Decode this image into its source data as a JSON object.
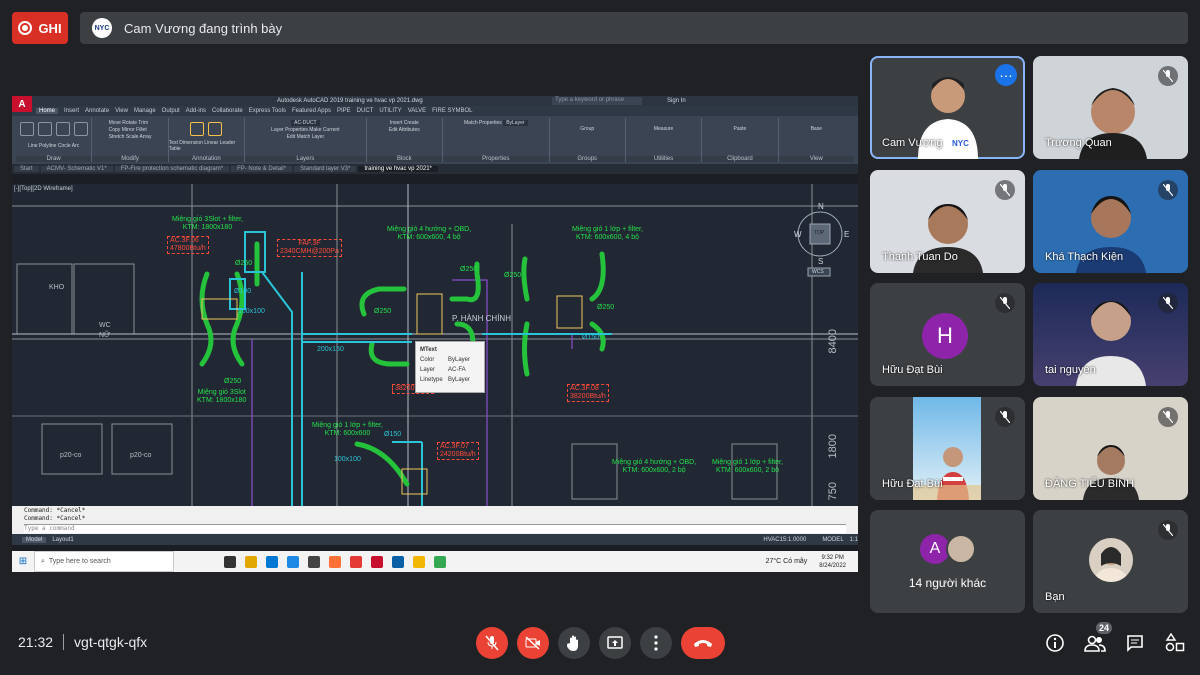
{
  "top": {
    "record_label": "GHI",
    "presenter_initials": "NYC",
    "presenter_text": "Cam Vương đang trình bày"
  },
  "acad": {
    "title": "Autodesk AutoCAD 2019   training ve hvac vp 2021.dwg",
    "search_placeholder": "Type a keyword or phrase",
    "sign_in": "Sign In",
    "logo": "A",
    "menu_tabs": [
      "Home",
      "Insert",
      "Annotate",
      "View",
      "Manage",
      "Output",
      "Add-ins",
      "Collaborate",
      "Express Tools",
      "Featured Apps",
      "PIPE",
      "DUCT",
      "UTILITY",
      "VALVE",
      "FIRE SYMBOL"
    ],
    "ribbon_groups": [
      "Draw",
      "Modify",
      "Annotation",
      "Layers",
      "Block",
      "Properties",
      "Groups",
      "Utilities",
      "Clipboard",
      "View"
    ],
    "ribbon_items": {
      "line": "Line",
      "polyline": "Polyline",
      "circle": "Circle",
      "arc": "Arc",
      "move": "Move",
      "rotate": "Rotate",
      "trim": "Trim",
      "copy": "Copy",
      "mirror": "Mirror",
      "fillet": "Fillet",
      "stretch": "Stretch",
      "scale": "Scale",
      "array": "Array",
      "text": "Text",
      "dimension": "Dimension",
      "linear": "Linear",
      "leader": "Leader",
      "table": "Table",
      "layer_properties": "Layer Properties",
      "layer_name": "AC-DUCT",
      "make_current": "Make Current",
      "edit": "Edit",
      "match_layer": "Match Layer",
      "insert": "Insert",
      "create": "Create",
      "edit_attributes": "Edit Attributes",
      "match_properties": "Match Properties",
      "bylayer": "ByLayer",
      "group": "Group",
      "measure": "Measure",
      "paste": "Paste",
      "base": "Base"
    },
    "doc_tabs": [
      "Start",
      "ACMV- Schematic V1*",
      "FP-Fire protection schematic diagram*",
      "FP- Note & Detail*",
      "Standard layer V3*",
      "training ve hvac vp 2021*"
    ],
    "viewport_label": "[-][Top][2D Wireframe]",
    "command_lines": [
      "Command: *Cancel*",
      "Command: *Cancel*"
    ],
    "command_placeholder": "Type a command",
    "layout_tabs": [
      "Model",
      "Layout1"
    ],
    "status_scale": "HVAC15:1.0000",
    "status_model": "MODEL",
    "status_zoom": "1:1"
  },
  "drawing": {
    "compass": {
      "n": "N",
      "s": "S",
      "e": "E",
      "w": "W",
      "top": "TOP",
      "wcs": "WCS"
    },
    "rooms": {
      "kho": "KHO",
      "wc": "WC",
      "nu": "NỮ",
      "hanh_chinh": "P. HÀNH CHÍNH",
      "p20_co_1": "p20-co",
      "p20_co_2": "p20-co"
    },
    "labels": {
      "grille_left": "Miệng gió 3Slot + filter,",
      "grille_left_ktm": "KTM: 1800x180",
      "ac_06": "AC.3F.06",
      "ac_06_btu": "47800Btu/h",
      "faf": "FAF.3F",
      "faf_cmh": "2340CMH@200Pa",
      "grille_4way": "Miệng gió 4 hướng + OBD,",
      "grille_4way_ktm": "KTM: 600x600, 4 bộ",
      "grille_1l": "Miệng gió 1 lớp + filter,",
      "grille_1l_ktm": "KTM: 600x600, 4 bộ",
      "grille_3slot_b": "Miệng gió 3Slot",
      "grille_3slot_b_ktm": "KTM: 1800x180",
      "ac_05_btu": "38200Btu/h",
      "ac_08": "AC.3F.08",
      "ac_08_btu": "38200Btu/h",
      "grille_1l_b": "Miệng gió 1 lớp + filter,",
      "grille_1l_b_ktm": "KTM: 600x600",
      "ac_07": "AC.3F.07",
      "ac_07_btu": "24200Btu/h",
      "grille_4way_b": "Miệng gió 4 hướng + OBD,",
      "grille_4way_b_ktm": "KTM: 600x600, 2 bộ",
      "grille_1l_c": "Miệng gió 1 lớp + filter,",
      "grille_1l_c_ktm": "KTM: 600x600, 2 bộ",
      "d250_a": "Ø250",
      "d250_b": "Ø250",
      "d250_c": "Ø250",
      "d250_d": "Ø250",
      "d250_e": "Ø250",
      "d150": "Ø150",
      "d100": "Ø100",
      "d150b": "Ø150",
      "duct_100x100": "100x100",
      "duct_200x150": "200x150",
      "duct_100x100b": "100x100",
      "dim_8400": "8400",
      "dim_1800": "1800",
      "dim_750": "750"
    },
    "tooltip": {
      "title": "MText",
      "rows": [
        {
          "k": "Color",
          "v": "ByLayer"
        },
        {
          "k": "Layer",
          "v": "AC-FA"
        },
        {
          "k": "Linetype",
          "v": "ByLayer"
        }
      ]
    }
  },
  "taskbar": {
    "search_placeholder": "Type here to search",
    "weather": "27°C  Có mây",
    "time": "9:32 PM",
    "date": "8/24/2022"
  },
  "participants": [
    {
      "name": "Cam Vương",
      "bg": "#e9ecef"
    },
    {
      "name": "Trương Quan",
      "bg": "#cfd4d8"
    },
    {
      "name": "Thanh Tuan Do",
      "bg": "#d9dde2"
    },
    {
      "name": "Khá Thạch Kiện",
      "bg": "#2d6eb3"
    },
    {
      "name": "Hữu Đạt Bùi",
      "initial": "H",
      "bg": "#3c4043"
    },
    {
      "name": "tai nguyen",
      "bg": "#2a3f70"
    },
    {
      "name": "Hữu Đạt Bùi",
      "bg": "#3c4043"
    },
    {
      "name": "ĐẶNG TIẾU BÌNH",
      "bg": "#d8d3c9"
    }
  ],
  "others": {
    "initial": "A",
    "label": "14 người khác"
  },
  "self": {
    "label": "Bạn"
  },
  "bottom": {
    "time": "21:32",
    "meeting_code": "vgt-qtgk-qfx",
    "people_count": "24"
  },
  "colors": {
    "accent_red": "#ea4335",
    "active_border": "#8ab4f8",
    "avatar_purple": "#8e24aa"
  }
}
